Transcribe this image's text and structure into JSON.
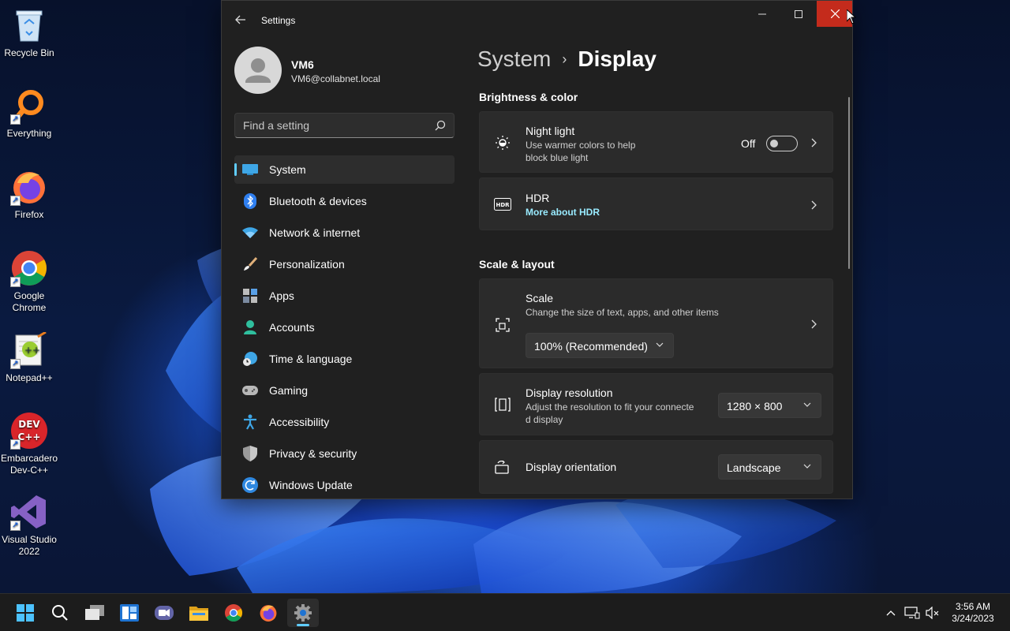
{
  "desktop": {
    "icons": [
      {
        "label": "Recycle Bin",
        "icon": "recycle-bin-icon"
      },
      {
        "label": "Everything",
        "icon": "everything-search-icon"
      },
      {
        "label": "Firefox",
        "icon": "firefox-icon"
      },
      {
        "label": "Google Chrome",
        "icon": "chrome-icon"
      },
      {
        "label": "Notepad++",
        "icon": "notepad-plus-plus-icon"
      },
      {
        "label": "Embarcadero Dev-C++",
        "icon": "dev-cpp-icon"
      },
      {
        "label": "Visual Studio 2022",
        "icon": "visual-studio-icon"
      }
    ],
    "devcpp_logo_text": "DEV C++",
    "notepad_logo_text": "++"
  },
  "window": {
    "title": "Settings",
    "back_icon": "arrow-left-icon",
    "profile": {
      "name": "VM6",
      "email": "VM6@collabnet.local"
    },
    "search": {
      "placeholder": "Find a setting",
      "value": ""
    },
    "nav": [
      {
        "label": "System",
        "icon": "system-icon",
        "selected": true
      },
      {
        "label": "Bluetooth & devices",
        "icon": "bluetooth-icon"
      },
      {
        "label": "Network & internet",
        "icon": "wifi-icon"
      },
      {
        "label": "Personalization",
        "icon": "brush-icon"
      },
      {
        "label": "Apps",
        "icon": "apps-icon"
      },
      {
        "label": "Accounts",
        "icon": "account-icon"
      },
      {
        "label": "Time & language",
        "icon": "clock-globe-icon"
      },
      {
        "label": "Gaming",
        "icon": "gamepad-icon"
      },
      {
        "label": "Accessibility",
        "icon": "accessibility-icon"
      },
      {
        "label": "Privacy & security",
        "icon": "shield-icon"
      },
      {
        "label": "Windows Update",
        "icon": "update-icon"
      }
    ],
    "breadcrumb": {
      "parent": "System",
      "separator": "›",
      "current": "Display"
    },
    "sections": {
      "brightness": {
        "title": "Brightness & color",
        "night_light": {
          "title": "Night light",
          "desc_line1": "Use warmer colors to help",
          "desc_line2": "block blue light",
          "state_label": "Off",
          "on": false
        },
        "hdr": {
          "title": "HDR",
          "link": "More about HDR",
          "badge": "HDR"
        }
      },
      "scale_layout": {
        "title": "Scale & layout",
        "scale": {
          "title": "Scale",
          "desc": "Change the size of text, apps, and other items",
          "value": "100% (Recommended)"
        },
        "resolution": {
          "title": "Display resolution",
          "desc_line1": "Adjust the resolution to fit your connecte",
          "desc_line2": "d display",
          "value": "1280 × 800"
        },
        "orientation": {
          "title": "Display orientation",
          "value": "Landscape"
        }
      }
    }
  },
  "taskbar": {
    "apps": [
      "start-icon",
      "search-icon",
      "task-view-icon",
      "widgets-icon",
      "teams-chat-icon",
      "file-explorer-icon",
      "chrome-icon",
      "firefox-icon",
      "settings-gear-icon"
    ],
    "active_app": "settings-gear-icon",
    "clock": {
      "time": "3:56 AM",
      "date": "3/24/2023"
    }
  },
  "colors": {
    "accent": "#60cdff",
    "close_hover": "#c42b1c",
    "window_bg": "#202020",
    "card_bg": "#2b2b2b",
    "link": "#99ebff"
  }
}
